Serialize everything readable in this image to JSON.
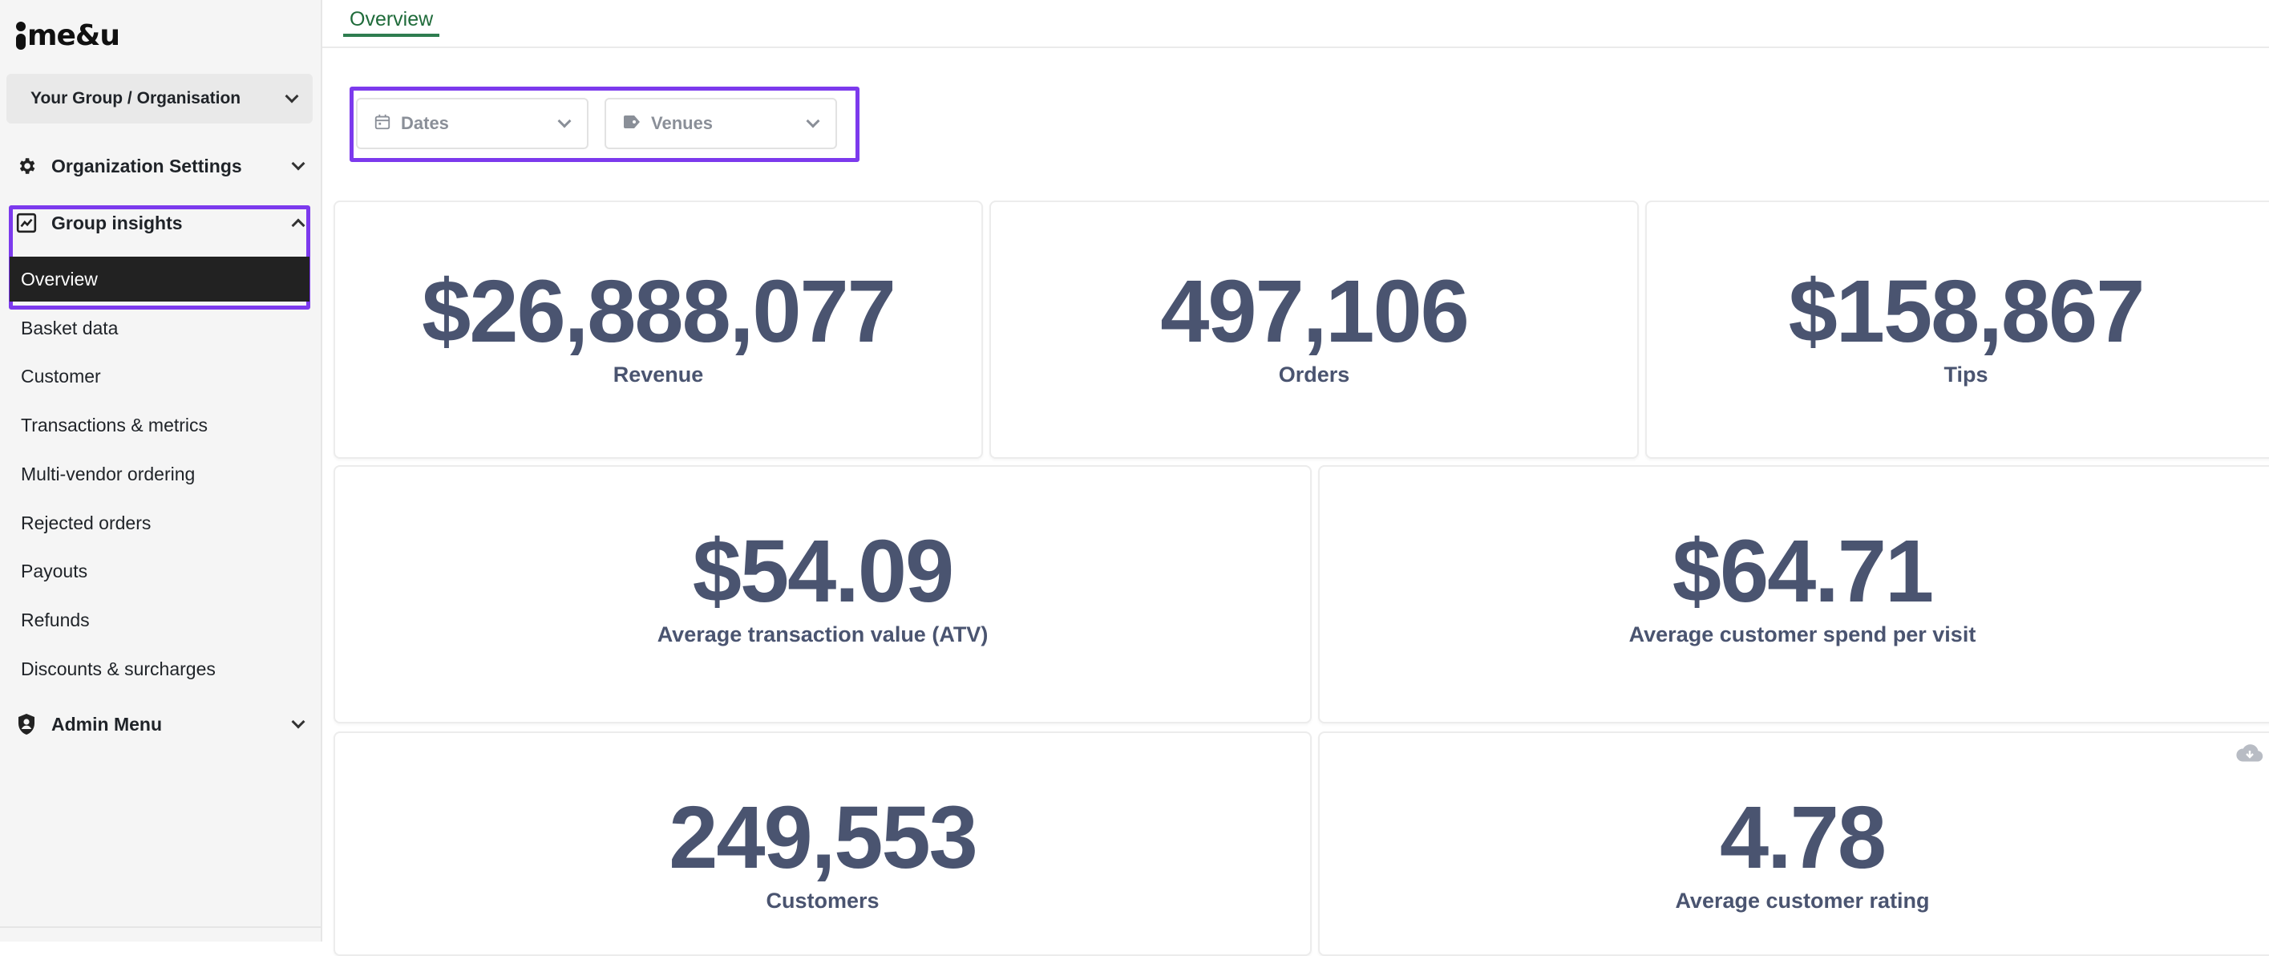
{
  "brand": {
    "logo_text": "me&u"
  },
  "sidebar": {
    "org_selector": "Your Group / Organisation",
    "sections": {
      "org_settings": "Organization Settings",
      "group_insights": "Group insights",
      "admin_menu": "Admin Menu"
    },
    "active_item": "Overview",
    "items": [
      "Basket data",
      "Customer",
      "Transactions & metrics",
      "Multi-vendor ordering",
      "Rejected orders",
      "Payouts",
      "Refunds",
      "Discounts & surcharges"
    ]
  },
  "tabs": {
    "active": "Overview"
  },
  "filters": {
    "dates": "Dates",
    "venues": "Venues"
  },
  "metrics": {
    "revenue": {
      "value": "$26,888,077",
      "label": "Revenue"
    },
    "orders": {
      "value": "497,106",
      "label": "Orders"
    },
    "tips": {
      "value": "$158,867",
      "label": "Tips"
    },
    "atv": {
      "value": "$54.09",
      "label": "Average transaction value (ATV)"
    },
    "spend_per_visit": {
      "value": "$64.71",
      "label": "Average customer spend per visit"
    },
    "customers": {
      "value": "249,553",
      "label": "Customers"
    },
    "rating": {
      "value": "4.78",
      "label": "Average customer rating"
    }
  },
  "colors": {
    "accent_highlight": "#7c3aed",
    "tab_active": "#2e7d4f",
    "metric_text": "#4a5470"
  }
}
